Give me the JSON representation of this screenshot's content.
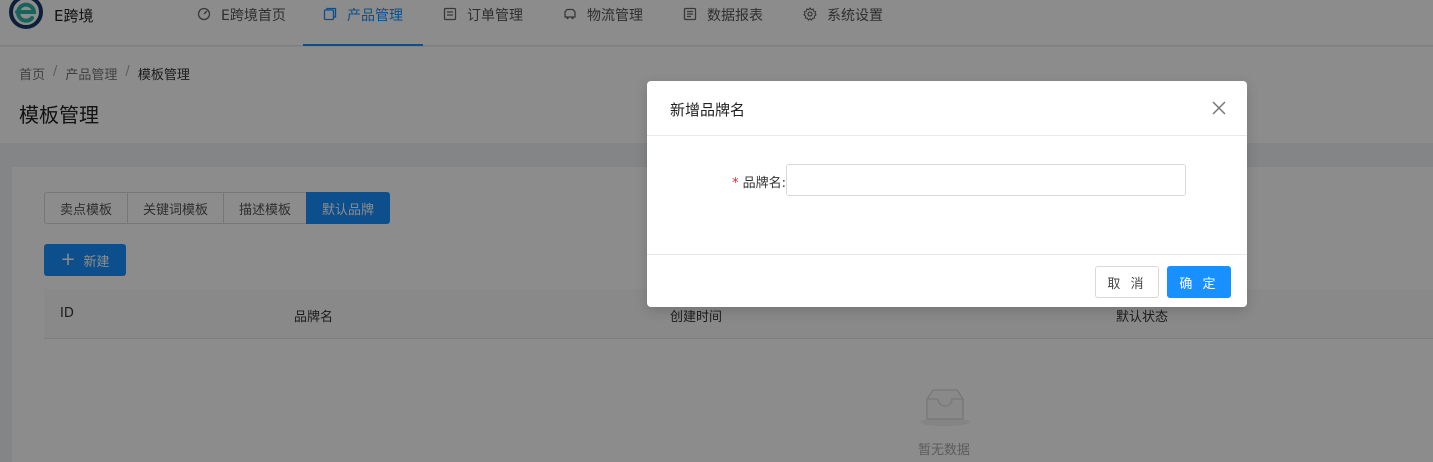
{
  "app": {
    "brand": "E跨境"
  },
  "nav": {
    "items": [
      {
        "label": "E跨境首页",
        "icon": "dashboard-icon",
        "active": false
      },
      {
        "label": "产品管理",
        "icon": "product-icon",
        "active": true
      },
      {
        "label": "订单管理",
        "icon": "order-icon",
        "active": false
      },
      {
        "label": "物流管理",
        "icon": "truck-icon",
        "active": false
      },
      {
        "label": "数据报表",
        "icon": "report-icon",
        "active": false
      },
      {
        "label": "系统设置",
        "icon": "gear-icon",
        "active": false
      }
    ]
  },
  "breadcrumb": [
    "首页",
    "产品管理",
    "模板管理"
  ],
  "page": {
    "title": "模板管理"
  },
  "tabs": [
    {
      "label": "卖点模板",
      "active": false
    },
    {
      "label": "关键词模板",
      "active": false
    },
    {
      "label": "描述模板",
      "active": false
    },
    {
      "label": "默认品牌",
      "active": true
    }
  ],
  "toolbar": {
    "new_label": "新建"
  },
  "table": {
    "columns": [
      "ID",
      "品牌名",
      "创建时间",
      "默认状态"
    ],
    "rows": [],
    "empty_text": "暂无数据"
  },
  "modal": {
    "title": "新增品牌名",
    "field": {
      "label": "品牌名",
      "required_mark": "*",
      "value": "",
      "placeholder": ""
    },
    "cancel_label": "取 消",
    "ok_label": "确 定"
  },
  "colors": {
    "primary": "#1890ff",
    "required": "#f5222d",
    "mask": "rgba(0,0,0,0.45)"
  }
}
